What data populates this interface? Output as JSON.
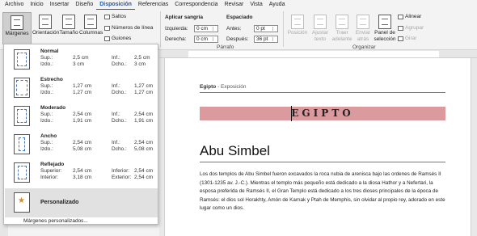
{
  "menu": [
    "Archivo",
    "Inicio",
    "Insertar",
    "Diseño",
    "Disposición",
    "Referencias",
    "Correspondencia",
    "Revisar",
    "Vista",
    "Ayuda"
  ],
  "ribbon": {
    "margins": "Márgenes",
    "orientation": "Orientación",
    "size": "Tamaño",
    "columns": "Columnas",
    "breaks": "Saltos",
    "line_numbers": "Números de línea",
    "hyphenation": "Guiones",
    "indent_title": "Aplicar sangría",
    "indent_left_label": "Izquierda:",
    "indent_left_value": "0 cm",
    "indent_right_label": "Derecha:",
    "indent_right_value": "0 cm",
    "spacing_title": "Espaciado",
    "spacing_before_label": "Antes:",
    "spacing_before_value": "0 pt",
    "spacing_after_label": "Después:",
    "spacing_after_value": "36 pt",
    "paragraph_group": "Párrafo",
    "position": "Posición",
    "wrap_text": "Ajustar texto",
    "bring_forward": "Traer adelante",
    "send_backward": "Enviar atrás",
    "selection_pane": "Panel de selección",
    "align": "Alinear",
    "group": "Agrupar",
    "rotate": "Girar",
    "arrange_group": "Organizar"
  },
  "margins_menu": {
    "options": [
      {
        "name": "Normal",
        "k1": "Sup.:",
        "v1": "2,5 cm",
        "k2": "Inf.:",
        "v2": "2,5 cm",
        "k3": "Izdo.:",
        "v3": "3 cm",
        "k4": "Dcho.:",
        "v4": "3 cm"
      },
      {
        "name": "Estrecho",
        "k1": "Sup.:",
        "v1": "1,27 cm",
        "k2": "Inf.:",
        "v2": "1,27 cm",
        "k3": "Izdo.:",
        "v3": "1,27 cm",
        "k4": "Dcho.:",
        "v4": "1,27 cm"
      },
      {
        "name": "Moderado",
        "k1": "Sup.:",
        "v1": "2,54 cm",
        "k2": "Inf.:",
        "v2": "2,54 cm",
        "k3": "Izdo.:",
        "v3": "1,91 cm",
        "k4": "Dcho.:",
        "v4": "1,91 cm"
      },
      {
        "name": "Ancho",
        "k1": "Sup.:",
        "v1": "2,54 cm",
        "k2": "Inf.:",
        "v2": "2,54 cm",
        "k3": "Izdo.:",
        "v3": "5,08 cm",
        "k4": "Dcho.:",
        "v4": "5,08 cm"
      },
      {
        "name": "Reflejado",
        "k1": "Superior:",
        "v1": "2,54 cm",
        "k2": "Inferior:",
        "v2": "2,54 cm",
        "k3": "Interior:",
        "v3": "3,18 cm",
        "k4": "Exterior:",
        "v4": "2,54 cm"
      }
    ],
    "custom": "Personalizado",
    "custom_link": "Márgenes personalizados..."
  },
  "document": {
    "header_title": "Egipto",
    "header_sep": " - ",
    "header_sub": "Exposición",
    "banner": "EGIPTO",
    "heading": "Abu Simbel",
    "paragraph": "Los dos templos de Abu Simbel fueron excavados la roca nubia de arenisca bajo las ordenes de Ramsés II (1301-1235 av. J.-C.). Mientras el templo más pequeño está dedicado a la diosa Hathor y a Nefertari, la esposa preferida de Ramsés II, el Gran Templo está dedicado a los tres dioses principales de la época de Ramsés: el dios sol Horakhty, Amón de Karnak y Ptah de Memphis, sin olvidar al propio rey, adorado en este lugar como un dios."
  }
}
